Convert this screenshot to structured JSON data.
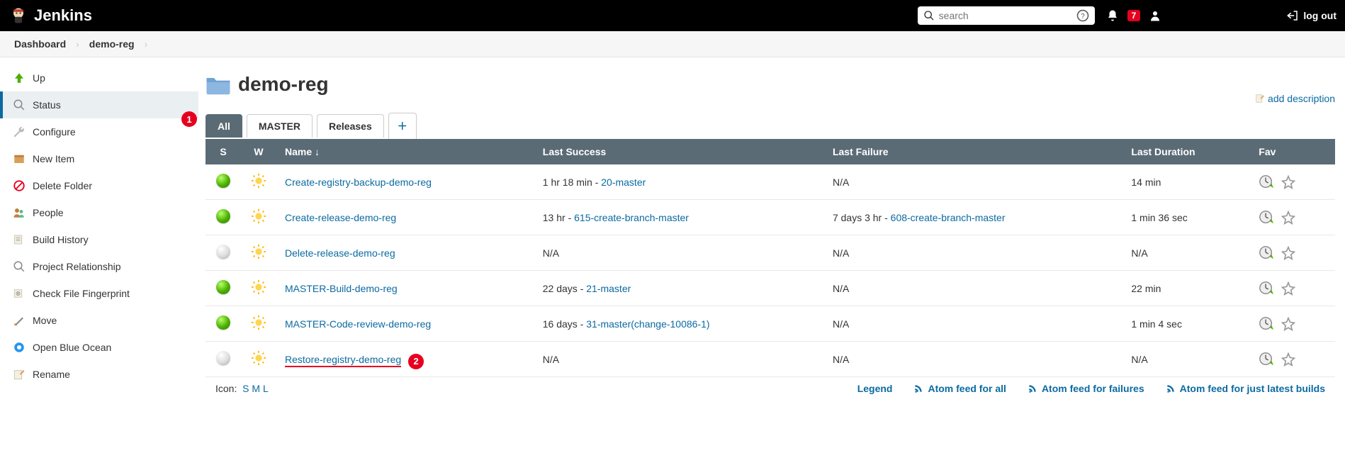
{
  "topbar": {
    "brand": "Jenkins",
    "search_placeholder": "search",
    "notif_count": "7",
    "logout": "log out"
  },
  "breadcrumb": {
    "items": [
      "Dashboard",
      "demo-reg"
    ]
  },
  "sidebar": {
    "items": [
      {
        "label": "Up",
        "icon": "up"
      },
      {
        "label": "Status",
        "icon": "status",
        "active": true
      },
      {
        "label": "Configure",
        "icon": "configure"
      },
      {
        "label": "New Item",
        "icon": "newitem"
      },
      {
        "label": "Delete Folder",
        "icon": "delete"
      },
      {
        "label": "People",
        "icon": "people"
      },
      {
        "label": "Build History",
        "icon": "history"
      },
      {
        "label": "Project Relationship",
        "icon": "relation"
      },
      {
        "label": "Check File Fingerprint",
        "icon": "fingerprint"
      },
      {
        "label": "Move",
        "icon": "move"
      },
      {
        "label": "Open Blue Ocean",
        "icon": "blueocean"
      },
      {
        "label": "Rename",
        "icon": "rename"
      }
    ]
  },
  "page": {
    "title": "demo-reg",
    "add_description": "add description"
  },
  "tabs": {
    "items": [
      "All",
      "MASTER",
      "Releases"
    ],
    "active_index": 0
  },
  "table": {
    "headers": {
      "s": "S",
      "w": "W",
      "name": "Name",
      "name_sort": "↓",
      "last_success": "Last Success",
      "last_failure": "Last Failure",
      "last_duration": "Last Duration",
      "fav": "Fav"
    },
    "rows": [
      {
        "status": "green",
        "weather": "sunny",
        "name": "Create-registry-backup-demo-reg",
        "last_success_text": "1 hr 18 min - ",
        "last_success_link": "20-master",
        "last_failure_text": "N/A",
        "last_failure_link": "",
        "last_duration": "14 min"
      },
      {
        "status": "green",
        "weather": "sunny",
        "name": "Create-release-demo-reg",
        "last_success_text": "13 hr - ",
        "last_success_link": "615-create-branch-master",
        "last_failure_text": "7 days 3 hr - ",
        "last_failure_link": "608-create-branch-master",
        "last_duration": "1 min 36 sec"
      },
      {
        "status": "grey",
        "weather": "sunny",
        "name": "Delete-release-demo-reg",
        "last_success_text": "N/A",
        "last_success_link": "",
        "last_failure_text": "N/A",
        "last_failure_link": "",
        "last_duration": "N/A"
      },
      {
        "status": "green",
        "weather": "sunny",
        "name": "MASTER-Build-demo-reg",
        "last_success_text": "22 days - ",
        "last_success_link": "21-master",
        "last_failure_text": "N/A",
        "last_failure_link": "",
        "last_duration": "22 min"
      },
      {
        "status": "green",
        "weather": "sunny",
        "name": "MASTER-Code-review-demo-reg",
        "last_success_text": "16 days - ",
        "last_success_link": "31-master(change-10086-1)",
        "last_failure_text": "N/A",
        "last_failure_link": "",
        "last_duration": "1 min 4 sec"
      },
      {
        "status": "grey",
        "weather": "sunny",
        "name": "Restore-registry-demo-reg",
        "name_underline": true,
        "last_success_text": "N/A",
        "last_success_link": "",
        "last_failure_text": "N/A",
        "last_failure_link": "",
        "last_duration": "N/A"
      }
    ]
  },
  "footer": {
    "icon_label": "Icon:",
    "sizes": [
      "S",
      "M",
      "L"
    ],
    "legend": "Legend",
    "feed_all": "Atom feed for all",
    "feed_failures": "Atom feed for failures",
    "feed_latest": "Atom feed for just latest builds"
  },
  "annotations": {
    "one": "1",
    "two": "2"
  }
}
